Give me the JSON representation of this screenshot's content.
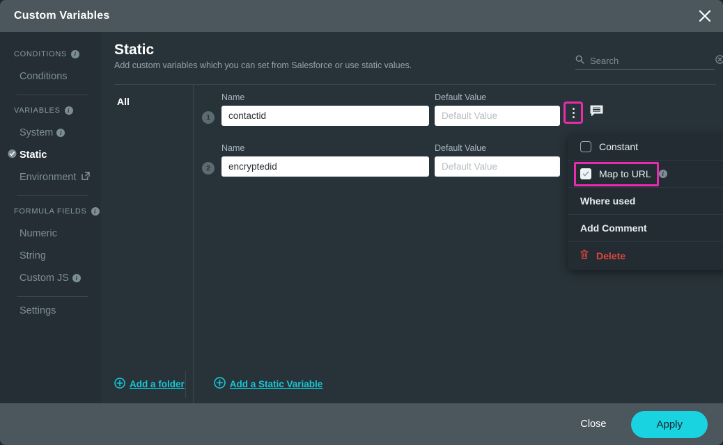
{
  "window": {
    "title": "Custom Variables",
    "close_icon": "close-icon"
  },
  "sidebar": {
    "groups": [
      {
        "label": "CONDITIONS",
        "has_info": true,
        "items": [
          {
            "label": "Conditions",
            "active": false,
            "has_info": false,
            "external": false
          }
        ]
      },
      {
        "label": "VARIABLES",
        "has_info": true,
        "items": [
          {
            "label": "System",
            "active": false,
            "has_info": true,
            "external": false
          },
          {
            "label": "Static",
            "active": true,
            "has_info": false,
            "external": false
          },
          {
            "label": "Environment",
            "active": false,
            "has_info": false,
            "external": true
          }
        ]
      },
      {
        "label": "FORMULA FIELDS",
        "has_info": true,
        "items": [
          {
            "label": "Numeric",
            "active": false,
            "has_info": false,
            "external": false
          },
          {
            "label": "String",
            "active": false,
            "has_info": false,
            "external": false
          },
          {
            "label": "Custom JS",
            "active": false,
            "has_info": true,
            "external": false
          }
        ]
      }
    ],
    "settings": {
      "label": "Settings"
    }
  },
  "main": {
    "title": "Static",
    "subtitle": "Add custom variables which you can set from Salesforce or use static values.",
    "search": {
      "placeholder": "Search",
      "value": "",
      "icon": "search-icon",
      "clear_icon": "clear-icon"
    },
    "folder": {
      "all_label": "All"
    },
    "columns": {
      "name": "Name",
      "default_value": "Default Value"
    },
    "rows": [
      {
        "number": "1",
        "name_label": "Name",
        "name_value": "contactid",
        "default_label": "Default Value",
        "default_value": "",
        "default_placeholder": "Default Value"
      },
      {
        "number": "2",
        "name_label": "Name",
        "name_value": "encryptedid",
        "default_label": "Default Value",
        "default_value": "",
        "default_placeholder": "Default Value"
      }
    ],
    "add_folder": {
      "label": "Add a folder",
      "icon": "plus-circle-icon"
    },
    "add_static": {
      "label": "Add a Static Variable",
      "icon": "plus-circle-icon"
    }
  },
  "context_menu": {
    "items": [
      {
        "label": "Constant",
        "control": "radio",
        "checked": false,
        "has_info": false,
        "danger": false,
        "bold": false,
        "highlighted": false
      },
      {
        "label": "Map to URL",
        "control": "checkbox",
        "checked": true,
        "has_info": true,
        "danger": false,
        "bold": false,
        "highlighted": true
      },
      {
        "label": "Where used",
        "control": "none",
        "checked": false,
        "has_info": false,
        "danger": false,
        "bold": true,
        "highlighted": false
      },
      {
        "label": "Add Comment",
        "control": "none",
        "checked": false,
        "has_info": false,
        "danger": false,
        "bold": true,
        "highlighted": false
      },
      {
        "label": "Delete",
        "control": "trash",
        "checked": false,
        "has_info": false,
        "danger": true,
        "bold": true,
        "highlighted": false
      }
    ]
  },
  "footer": {
    "close_label": "Close",
    "apply_label": "Apply"
  },
  "colors": {
    "highlight_magenta": "#ea2bae",
    "accent_cyan": "#1ad3e0",
    "link_cyan": "#16c8d6",
    "danger_red": "#e0453c",
    "titlebar": "#4b565d",
    "panel_bg": "#283339",
    "sidebar_bg": "#242e34",
    "menu_bg": "#222c32"
  }
}
